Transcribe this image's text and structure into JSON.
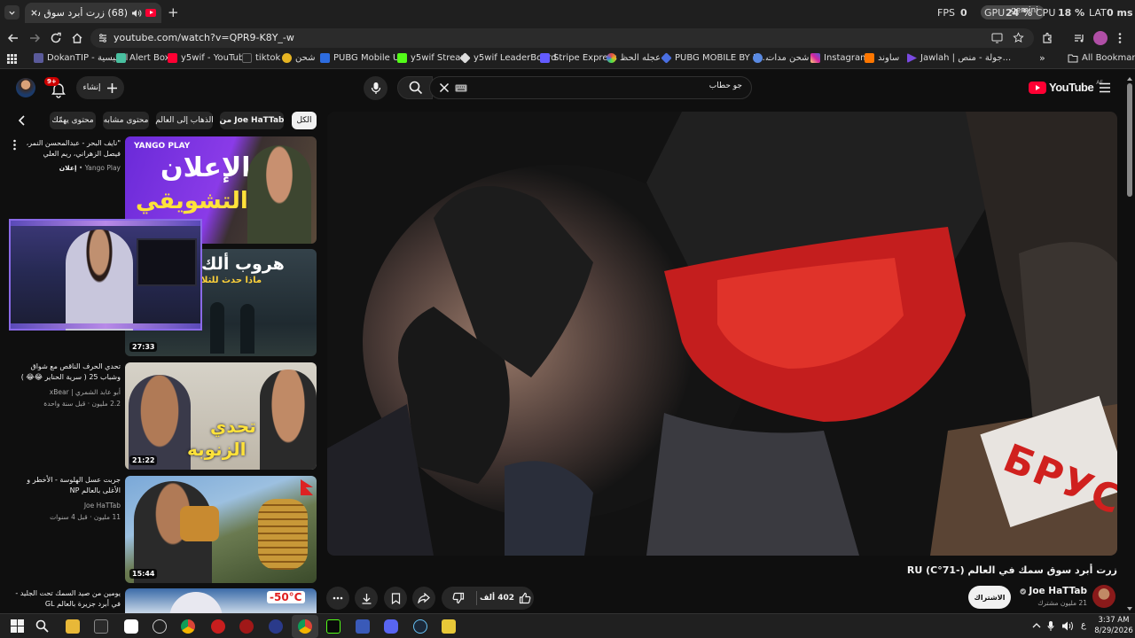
{
  "browser": {
    "tab_title": "(68) زرت أبرد سوق سمك في",
    "new_tab_symbol": "+",
    "url": "youtube.com/watch?v=QPR9-K8Y_-w",
    "bookmarks": [
      {
        "label": "DokanTIP - الرئيسية",
        "color": "#5a5a9a"
      },
      {
        "label": "Alert Box",
        "color": "#49c0a0"
      },
      {
        "label": "y5wif - YouTube",
        "color": "#ff0033"
      },
      {
        "label": "tiktok",
        "color": "#222222"
      },
      {
        "label": "شحن",
        "color": "#e6b422"
      },
      {
        "label": "PUBG Mobile UC",
        "color": "#2d6cdf"
      },
      {
        "label": "y5wif Stream",
        "color": "#53fc18"
      },
      {
        "label": "y5wif LeaderBoard",
        "color": "#dddddd"
      },
      {
        "label": "Stripe Express",
        "color": "#635bff"
      },
      {
        "label": "عجله الحظ",
        "color": "#e24a4a"
      },
      {
        "label": "PUBG MOBILE BY ID...",
        "color": "#4a6fe2"
      },
      {
        "label": "شحن مدات",
        "color": "#5a8ae2"
      },
      {
        "label": "Instagram",
        "color": "#d6249f"
      },
      {
        "label": "ساوند",
        "color": "#ff7700"
      },
      {
        "label": "Jawlah | جولة - منص...",
        "color": "#7a4ae2"
      }
    ],
    "all_bookmarks_label": "All Bookmarks"
  },
  "overlay_stats": {
    "fps_label": "FPS",
    "fps_value": "0",
    "gpu_label": "GPU",
    "gpu_value": "24 %",
    "cpu_label": "CPU",
    "cpu_value": "18 %",
    "lat_label": "LAT",
    "lat_value": "0 ms",
    "brand_label": "gemini"
  },
  "youtube": {
    "logo_text": "YouTube",
    "logo_region": "AE",
    "search_query": "جو حطاب",
    "create_label": "إنشاء",
    "notification_count": "9+",
    "chips": [
      "الكل",
      "من Joe HaTTab",
      "الذهاب إلى العالم",
      "محتوى مشابه",
      "محتوى يهمّك"
    ],
    "video_title": "زرت أبرد سوق سمك في العالم (-71°C) RU",
    "channel_name": "Joe HaTTab",
    "subscribers": "21 مليون مشترك",
    "subscribe_label": "الاشتراك",
    "likes": "402 ألف"
  },
  "sidebar_videos": [
    {
      "title": "\"نايف البحر - عبدالمحسن النمر، فيصل الزهراني، ريم العلي مسلسل...",
      "channel": "Yango Play",
      "meta": "إعلان",
      "thumb_text_1": "الإعلان",
      "thumb_text_2": "التشويقي",
      "badge": "YANGO PLAY",
      "duration": ""
    },
    {
      "title": "",
      "channel": "",
      "meta": "",
      "thumb_text_1": "هروب ألك",
      "thumb_text_2": "ماذا حدث للثلا",
      "badge": "",
      "duration": "27:33"
    },
    {
      "title": "تحدي الحرف الناقص مع شواق وشباب 25 ( سرية الحناير 😂😂 )",
      "channel": "أبو عابد الشمري | xBear",
      "meta": "2.2 مليون · قبل سنة واحدة",
      "thumb_text_1": "تحدي",
      "thumb_text_2": "الزنوبه",
      "badge": "",
      "duration": "21:22"
    },
    {
      "title": "جربت عسل الهلوسة - الأخطر و الأغلى بالعالم NP",
      "channel": "Joe HaTTab",
      "meta": "11 مليون · قبل 4 سنوات",
      "thumb_text_1": "",
      "thumb_text_2": "",
      "badge": "",
      "duration": "15:44"
    },
    {
      "title": "يومين من صيد السمك تحت الجليد - في أبرد جزيرة بالعالم GL",
      "channel": "",
      "meta": "",
      "thumb_text_1": "-50°C",
      "thumb_text_2": "",
      "badge": "",
      "duration": ""
    }
  ],
  "player_overlay_text": "БРУС",
  "taskbar": {
    "time": "3:37 AM",
    "date": "8/29/2026",
    "lang": "ع"
  }
}
